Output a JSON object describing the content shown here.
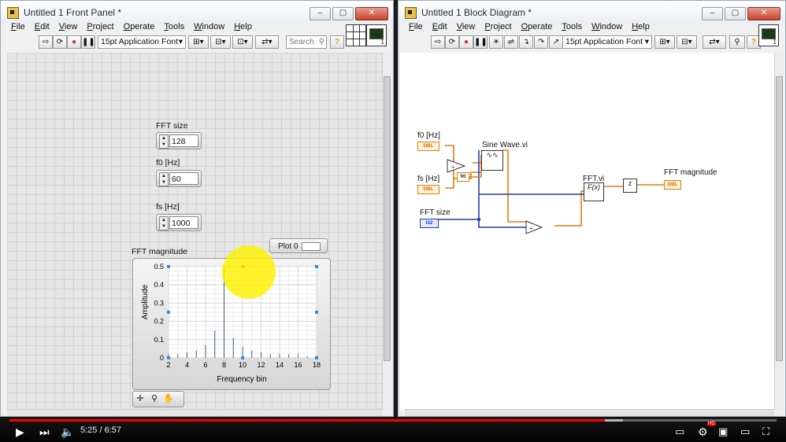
{
  "front_panel": {
    "title": "Untitled 1 Front Panel *",
    "menu": [
      "File",
      "Edit",
      "View",
      "Project",
      "Operate",
      "Tools",
      "Window",
      "Help"
    ],
    "font_selector": "15pt Application Font",
    "search_placeholder": "Search",
    "controls": [
      {
        "label": "FFT size",
        "value": "128"
      },
      {
        "label": "f0 [Hz]",
        "value": "60"
      },
      {
        "label": "fs [Hz]",
        "value": "1000"
      }
    ],
    "graph": {
      "title": "FFT magnitude",
      "legend_label": "Plot 0",
      "xlabel": "Frequency bin",
      "ylabel": "Amplitude"
    }
  },
  "block_diagram": {
    "title": "Untitled 1 Block Diagram *",
    "menu": [
      "File",
      "Edit",
      "View",
      "Project",
      "Operate",
      "Tools",
      "Window",
      "Help"
    ],
    "font_selector": "15pt Application Font",
    "labels": {
      "f0": "f0 [Hz]",
      "fs": "fs [Hz]",
      "fft_size": "FFT size",
      "sine_wave": "Sine Wave.vi",
      "fft_vi": "FFT.vi",
      "fft_mag": "FFT magnitude",
      "const": "90",
      "dbl": "DBL",
      "i32": "I32"
    }
  },
  "player": {
    "time": "5:25 / 6:57",
    "played_fraction": 0.776,
    "buffered_fraction": 0.8
  },
  "colors": {
    "dbl_wire": "#e07b10",
    "i32_wire": "#1a3fb0",
    "progress": "#ff0000"
  },
  "chart_data": {
    "type": "bar",
    "x": [
      2,
      3,
      4,
      5,
      6,
      7,
      8,
      9,
      10,
      11,
      12,
      13,
      14,
      15,
      16,
      17,
      18
    ],
    "values": [
      0.02,
      0.02,
      0.03,
      0.04,
      0.07,
      0.15,
      0.5,
      0.11,
      0.06,
      0.04,
      0.03,
      0.02,
      0.02,
      0.02,
      0.02,
      0.01,
      0.01
    ],
    "xlabel": "Frequency bin",
    "ylabel": "Amplitude",
    "xlim": [
      2,
      18
    ],
    "ylim": [
      0,
      0.5
    ],
    "xticks": [
      2,
      4,
      6,
      8,
      10,
      12,
      14,
      16,
      18
    ],
    "yticks": [
      0,
      0.1,
      0.2,
      0.3,
      0.4,
      0.5
    ],
    "grid": true
  }
}
